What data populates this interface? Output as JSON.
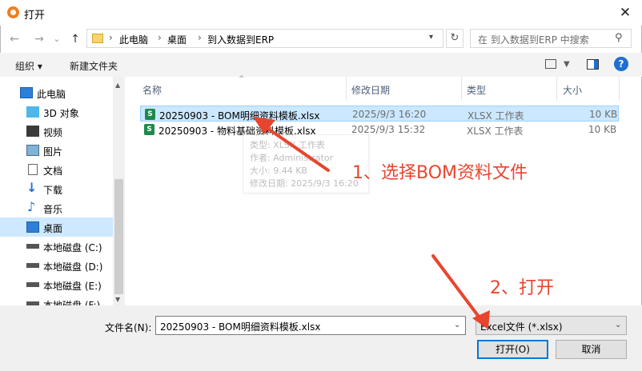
{
  "window": {
    "title": "打开"
  },
  "nav": {
    "back": "←",
    "forward": "→",
    "recent": "⌄",
    "up": "↑",
    "breadcrumbs": [
      "此电脑",
      "桌面",
      "到入数据到ERP"
    ],
    "breadcrumb_sep": "›",
    "refresh": "↻",
    "search_placeholder": "在 到入数据到ERP 中搜索"
  },
  "toolbar": {
    "organize": "组织 ▾",
    "new_folder": "新建文件夹",
    "help": "?"
  },
  "sidebar": {
    "items": [
      {
        "label": "此电脑",
        "icon": "pc-icon"
      },
      {
        "label": "3D 对象",
        "icon": "3d-objects-icon"
      },
      {
        "label": "视频",
        "icon": "video-icon"
      },
      {
        "label": "图片",
        "icon": "pictures-icon"
      },
      {
        "label": "文档",
        "icon": "documents-icon"
      },
      {
        "label": "下载",
        "icon": "downloads-icon"
      },
      {
        "label": "音乐",
        "icon": "music-icon"
      },
      {
        "label": "桌面",
        "icon": "desktop-icon",
        "selected": true
      },
      {
        "label": "本地磁盘 (C:)",
        "icon": "drive-icon"
      },
      {
        "label": "本地磁盘 (D:)",
        "icon": "drive-icon"
      },
      {
        "label": "本地磁盘 (E:)",
        "icon": "drive-icon"
      },
      {
        "label": "本地磁盘 (F:)",
        "icon": "drive-icon"
      }
    ]
  },
  "columns": [
    "名称",
    "修改日期",
    "类型",
    "大小"
  ],
  "files": [
    {
      "name": "20250903 - BOM明细资料模板.xlsx",
      "date": "2025/9/3 16:20",
      "type": "XLSX 工作表",
      "size": "10 KB",
      "selected": true
    },
    {
      "name": "20250903 - 物料基础资料模板.xlsx",
      "date": "2025/9/3 15:32",
      "type": "XLSX 工作表",
      "size": "10 KB",
      "selected": false
    }
  ],
  "tooltip": {
    "lines": [
      "类型: XLSX 工作表",
      "作者: Administrator",
      "大小: 9.44 KB",
      "修改日期: 2025/9/3 16:20"
    ]
  },
  "bottom": {
    "filename_label": "文件名(N):",
    "filename_value": "20250903 - BOM明细资料模板.xlsx",
    "filetype_value": "Excel文件 (*.xlsx)",
    "open_label": "打开(O)",
    "cancel_label": "取消"
  },
  "annotations": {
    "step1": "1、选择BOM资料文件",
    "step2": "2、打开"
  },
  "colors": {
    "annotation": "#e8452e",
    "selection": "#cce8ff",
    "accent": "#0078d7"
  }
}
